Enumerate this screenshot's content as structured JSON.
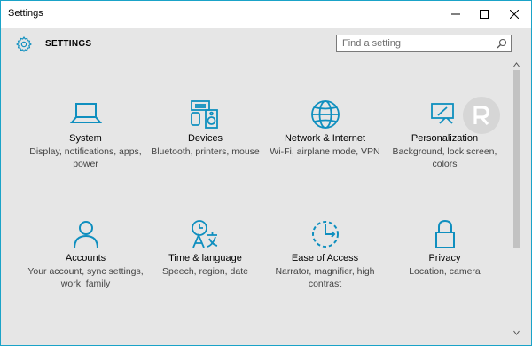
{
  "window": {
    "title": "Settings"
  },
  "header": {
    "title": "SETTINGS",
    "search_placeholder": "Find a setting"
  },
  "categories": [
    {
      "name": "System",
      "desc": "Display, notifications, apps, power",
      "icon": "laptop-icon"
    },
    {
      "name": "Devices",
      "desc": "Bluetooth, printers, mouse",
      "icon": "devices-icon"
    },
    {
      "name": "Network & Internet",
      "desc": "Wi-Fi, airplane mode, VPN",
      "icon": "globe-icon"
    },
    {
      "name": "Personalization",
      "desc": "Background, lock screen, colors",
      "icon": "paint-icon"
    },
    {
      "name": "Accounts",
      "desc": "Your account, sync settings, work, family",
      "icon": "person-icon"
    },
    {
      "name": "Time & language",
      "desc": "Speech, region, date",
      "icon": "clock-language-icon"
    },
    {
      "name": "Ease of Access",
      "desc": "Narrator, magnifier, high contrast",
      "icon": "ease-of-access-icon"
    },
    {
      "name": "Privacy",
      "desc": "Location, camera",
      "icon": "lock-icon"
    }
  ],
  "colors": {
    "accent": "#0f8fbf",
    "window_border": "#1aa3c8",
    "background": "#e6e6e6"
  }
}
